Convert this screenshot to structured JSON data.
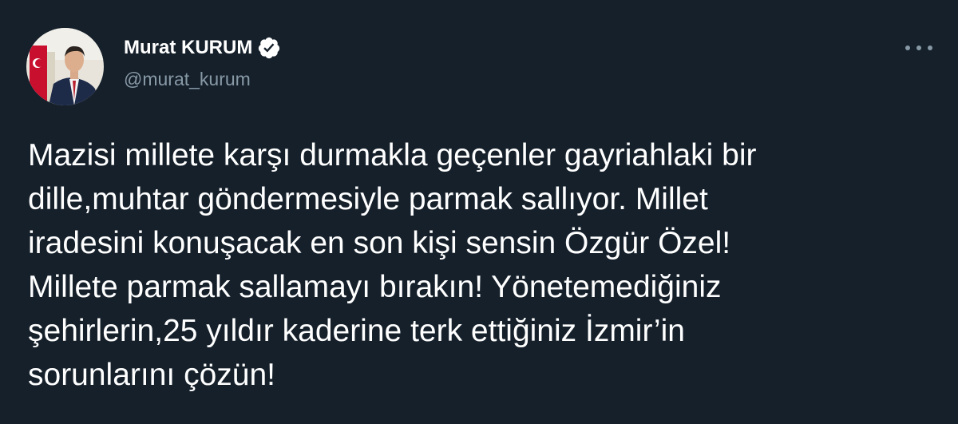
{
  "author": {
    "display_name": "Murat KURUM",
    "handle": "@murat_kurum",
    "verified": true,
    "avatar_icon": "profile-photo-avatar"
  },
  "menu": {
    "more_icon": "more-options-dots-icon"
  },
  "tweet": {
    "text": "Mazisi millete karşı durmakla geçenler gayriahlaki bir\ndille,muhtar göndermesiyle parmak sallıyor. Millet\niradesini konuşacak en son kişi sensin Özgür Özel!\nMillete parmak sallamayı bırakın! Yönetemediğiniz\nşehirlerin,25 yıldır kaderine terk ettiğiniz İzmir’in\nsorunlarını çözün!"
  },
  "colors": {
    "background": "#15202b",
    "text_primary": "#ffffff",
    "text_secondary": "#8899a6",
    "verified_badge": "#ffffff"
  }
}
